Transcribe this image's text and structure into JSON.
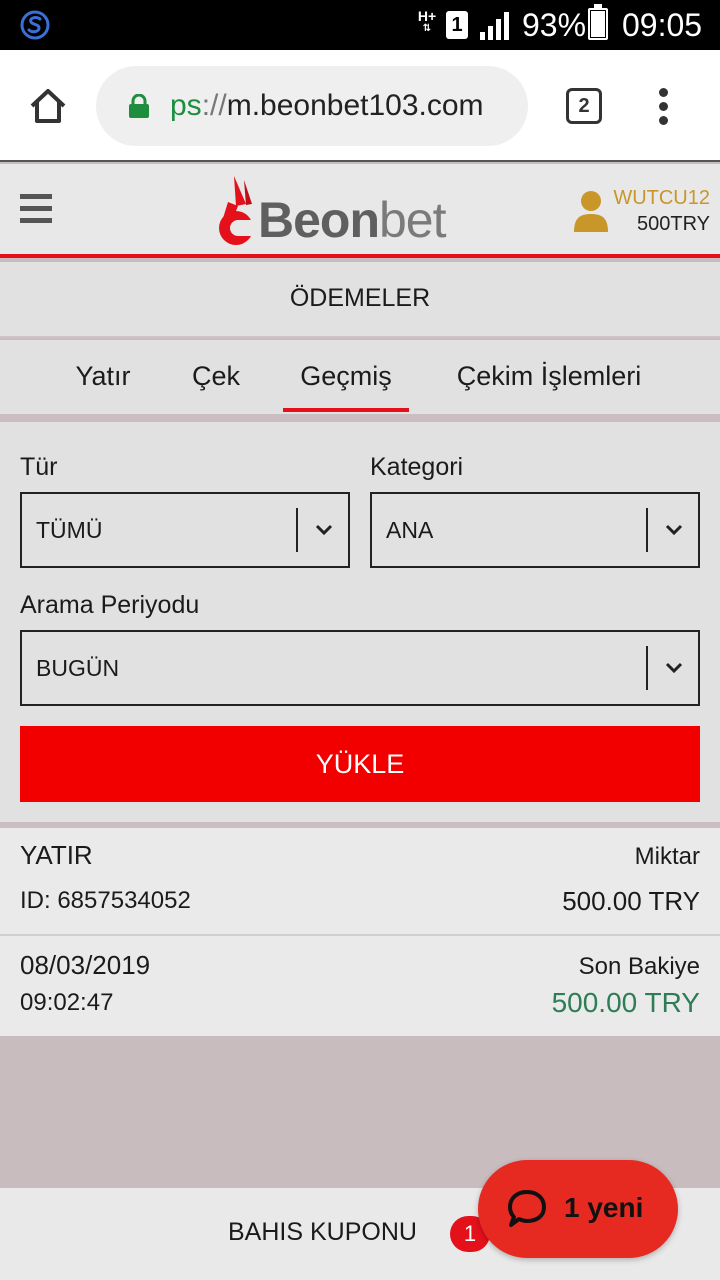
{
  "status_bar": {
    "network": "H+",
    "sim_slot": "1",
    "battery_percent": "93%",
    "time": "09:05",
    "icons": [
      "app-s-icon",
      "network-hplus-icon",
      "sim-icon",
      "signal-icon",
      "battery-icon"
    ]
  },
  "browser": {
    "url_scheme": "ps",
    "url_separator": "://",
    "url_host": "m.beonbet103.com",
    "tab_count": "2",
    "icons": [
      "home-icon",
      "lock-icon",
      "tabs-icon",
      "menu-dots-icon"
    ]
  },
  "header": {
    "logo_word_bold": "Beon",
    "logo_word_light": "bet",
    "username": "WUTCU12",
    "balance": "500TRY",
    "colors": {
      "brand_red": "#e4111b",
      "username": "#c9962a"
    },
    "icons": [
      "hamburger-icon",
      "logo-mark-icon",
      "user-icon"
    ]
  },
  "page": {
    "title": "ÖDEMELER"
  },
  "tabs": [
    {
      "label": "Yatır",
      "active": false
    },
    {
      "label": "Çek",
      "active": false
    },
    {
      "label": "Geçmiş",
      "active": true
    },
    {
      "label": "Çekim İşlemleri",
      "active": false
    }
  ],
  "filters": {
    "type_label": "Tür",
    "type_value": "TÜMÜ",
    "category_label": "Kategori",
    "category_value": "ANA",
    "period_label": "Arama Periyodu",
    "period_value": "BUGÜN",
    "load_button": "YÜKLE",
    "colors": {
      "button": "#f20000"
    }
  },
  "record": {
    "type": "YATIR",
    "amount_label": "Miktar",
    "id": "ID: 6857534052",
    "amount": "500.00 TRY",
    "date": "08/03/2019",
    "time": "09:02:47",
    "balance_label": "Son Bakiye",
    "balance_value": "500.00 TRY",
    "colors": {
      "balance": "#2e7d55"
    }
  },
  "bottom": {
    "coupon_label": "BAHIS KUPONU",
    "coupon_count": "1",
    "chat_label": "1 yeni",
    "icons": [
      "chat-bubble-icon"
    ]
  }
}
